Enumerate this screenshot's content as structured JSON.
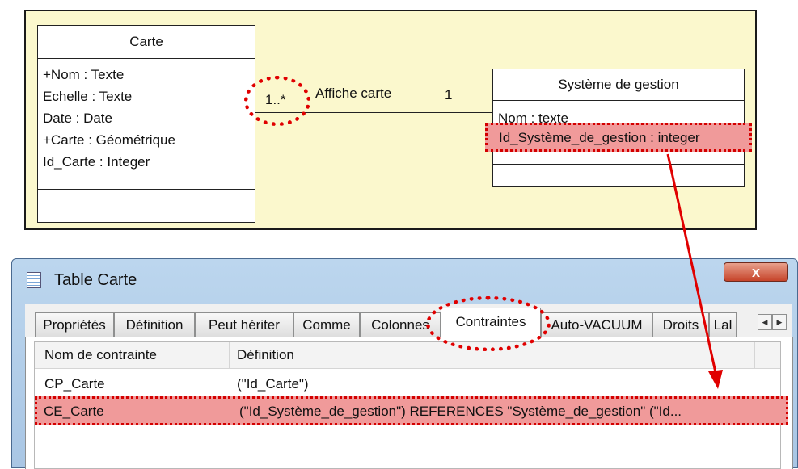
{
  "uml": {
    "carte": {
      "name": "Carte",
      "attributes": [
        "+Nom : Texte",
        "Echelle : Texte",
        "Date : Date",
        "+Carte : Géométrique",
        "Id_Carte : Integer"
      ]
    },
    "systeme": {
      "name": "Système de gestion",
      "attributes": [
        "Nom : texte",
        "Id_Système_de_gestion : integer"
      ]
    },
    "association": {
      "name": "Affiche carte",
      "multiplicity_left": "1..*",
      "multiplicity_right": "1"
    }
  },
  "window": {
    "title": "Table Carte",
    "close_label": "x",
    "tabs": [
      {
        "label": "Propriétés"
      },
      {
        "label": "Définition"
      },
      {
        "label": "Peut hériter"
      },
      {
        "label": "Comme"
      },
      {
        "label": "Colonnes"
      },
      {
        "label": "Contraintes"
      },
      {
        "label": "Auto-VACUUM"
      },
      {
        "label": "Droits"
      },
      {
        "label": "Lal"
      }
    ],
    "active_tab": "Contraintes",
    "scroll_left": "◀",
    "scroll_right": "▶",
    "grid": {
      "headers": [
        "Nom de contrainte",
        "Définition"
      ],
      "rows": [
        {
          "name": "CP_Carte",
          "definition": "(\"Id_Carte\")"
        },
        {
          "name": "CE_Carte",
          "definition": "(\"Id_Système_de_gestion\")    REFERENCES \"Système_de_gestion\" (\"Id..."
        }
      ]
    }
  },
  "colors": {
    "highlight": "#f09a9a",
    "annotation": "#e00000",
    "diagram_bg": "#fbf8cd"
  }
}
